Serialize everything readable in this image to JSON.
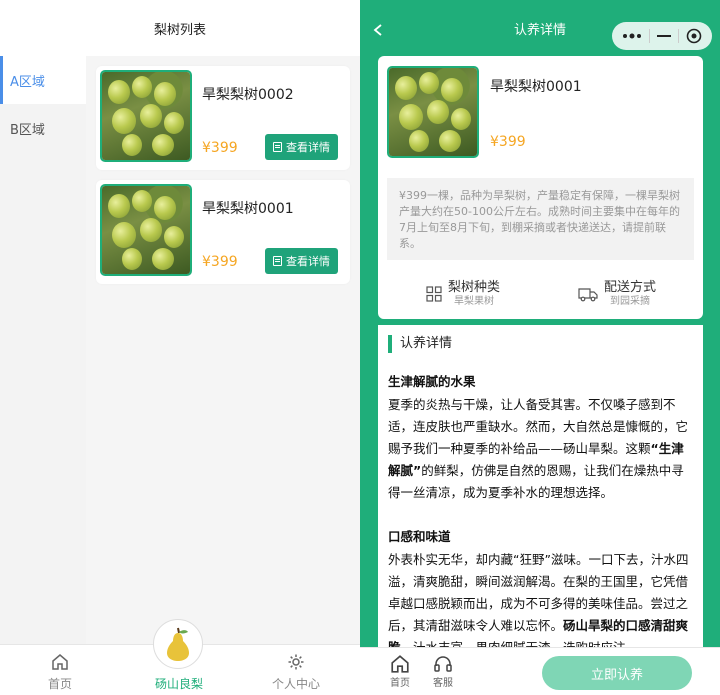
{
  "left": {
    "header_title": "梨树列表",
    "categories": [
      {
        "label": "A区域",
        "active": true
      },
      {
        "label": "B区域",
        "active": false
      }
    ],
    "trees": [
      {
        "name": "旱梨梨树0002",
        "price": "¥399",
        "button": "查看详情"
      },
      {
        "name": "旱梨梨树0001",
        "price": "¥399",
        "button": "查看详情"
      }
    ],
    "tabbar": {
      "home": "首页",
      "center": "砀山良梨",
      "profile": "个人中心"
    }
  },
  "right": {
    "header_title": "认养详情",
    "tree": {
      "name": "旱梨梨树0001",
      "price": "¥399",
      "description": "¥399一棵，品种为旱梨树，产量稳定有保障，一棵旱梨树产量大约在50-100公斤左右。成熟时间主要集中在每年的7月上旬至8月下旬，到棚采摘或者快递送达，请提前联系。"
    },
    "meta": {
      "type_title": "梨树种类",
      "type_value": "旱梨果树",
      "delivery_title": "配送方式",
      "delivery_value": "到园采摘"
    },
    "section_title": "认养详情",
    "article": {
      "h1": "生津解腻的水果",
      "p1a": "夏季的炎热与干燥，让人备受其害。不仅嗓子感到不适，连皮肤也严重缺水。然而，大自然总是慷慨的，它赐予我们一种夏季的补给品——砀山旱梨。这颗",
      "p1b": "“生津解腻”",
      "p1c": "的鲜梨，仿佛是自然的恩赐，让我们在燥热中寻得一丝清凉，成为夏季补水的理想选择。",
      "h2": "口感和味道",
      "p2a": "外表朴实无华，却内藏“狂野”滋味。一口下去，汁水四溢，清爽脆甜，瞬间滋润解渴。在梨的王国里，它凭借卓越口感脱颖而出，成为不可多得的美味佳品。尝过之后，其清甜滋味令人难以忘怀。",
      "p2b": "砀山旱梨的口感清甜爽脆",
      "p2c": "，汁水丰富，果肉细腻无渣，选购时应注"
    },
    "bottom": {
      "home": "首页",
      "service": "客服",
      "adopt": "立即认养"
    }
  },
  "colors": {
    "brand_green": "#1fae7a",
    "price_orange": "#f5a623",
    "active_blue": "#4a8ee8"
  }
}
